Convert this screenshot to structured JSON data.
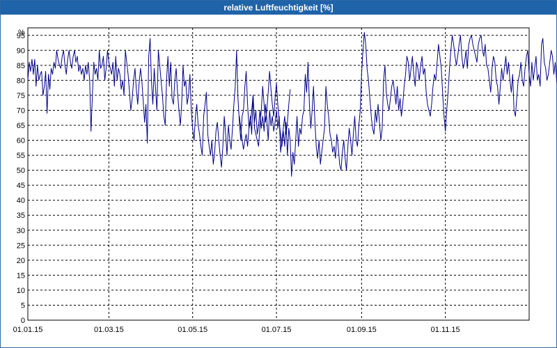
{
  "window": {
    "title": "relative Luftfeuchtigkeit [%]"
  },
  "colors": {
    "titlebar": "#1f63a8",
    "series": "#00008b",
    "grid": "#000000"
  },
  "chart_data": {
    "type": "line",
    "title": "relative Luftfeuchtigkeit [%]",
    "ylabel": "%",
    "ylim": [
      0,
      97.5
    ],
    "xlim": [
      "2015-01-01",
      "2016-01-01"
    ],
    "grid": true,
    "y_ticks": [
      0,
      5,
      10,
      15,
      20,
      25,
      30,
      35,
      40,
      45,
      50,
      55,
      60,
      65,
      70,
      75,
      80,
      85,
      90,
      95
    ],
    "x_ticks": [
      "01.01.15",
      "01.03.15",
      "01.05.15",
      "01.07.15",
      "01.09.15",
      "01.11.15"
    ],
    "x_tick_dates": [
      "2015-01-01",
      "2015-03-01",
      "2015-05-01",
      "2015-07-01",
      "2015-09-01",
      "2015-11-01"
    ],
    "series": [
      {
        "name": "",
        "segments": [
          {
            "start": "2015-01-01",
            "values": [
              80,
              86,
              83,
              87,
              82,
              87,
              78,
              85,
              80,
              82,
              83,
              75,
              78,
              83,
              69,
              82,
              77,
              84,
              82,
              86,
              84,
              90,
              87,
              85,
              84,
              88,
              90,
              85,
              82,
              87,
              90,
              86,
              84,
              88,
              90,
              86,
              88,
              83,
              85,
              82,
              84,
              80,
              85,
              82,
              86,
              80,
              63,
              75,
              86,
              82,
              84,
              80,
              90,
              84,
              85,
              88,
              80,
              84,
              90,
              86,
              84,
              82,
              86,
              78,
              88,
              80,
              84,
              82,
              77,
              80,
              75,
              90,
              86,
              82,
              76,
              70,
              74,
              80,
              84,
              77,
              72,
              79,
              84,
              80,
              73,
              66,
              72,
              59,
              88,
              94,
              80,
              72,
              84,
              77,
              70,
              90,
              85,
              80,
              75,
              68,
              65,
              80,
              88,
              78,
              86,
              74,
              72,
              80,
              84,
              76,
              70,
              65,
              72,
              85,
              78,
              80,
              72,
              75,
              82,
              70,
              64,
              60,
              68,
              72,
              65,
              62,
              58,
              55,
              68,
              72,
              76,
              62,
              58,
              55,
              60,
              52,
              56,
              63,
              66,
              60,
              55,
              51,
              58,
              68,
              62,
              55,
              65,
              60,
              57,
              64,
              72,
              78,
              90,
              74,
              66,
              60,
              68,
              70,
              78,
              83,
              72,
              64,
              68,
              62,
              75,
              66,
              70,
              62,
              65,
              70,
              64,
              68,
              63,
              72,
              67,
              60,
              70,
              65,
              68,
              63,
              66,
              70,
              64,
              68,
              56,
              60,
              64,
              68,
              62,
              66,
              72,
              77
            ]
          },
          {
            "start": "2015-06-04",
            "values": [
              68,
              64,
              60,
              57,
              60,
              62,
              58,
              64,
              66,
              70,
              75,
              64,
              62,
              60,
              58,
              65,
              70,
              78,
              72,
              66,
              70,
              76,
              83,
              77,
              72,
              68,
              74,
              79,
              72,
              66,
              62,
              58,
              63,
              58,
              66,
              55,
              64,
              60,
              48,
              56,
              52,
              60,
              68,
              58,
              64,
              62,
              68,
              70,
              82,
              76,
              86,
              72,
              64,
              70,
              78,
              66,
              58,
              54,
              60,
              52,
              56,
              60,
              64,
              78,
              72,
              68,
              62,
              60,
              56,
              58,
              54,
              62,
              58,
              52,
              50,
              56,
              60,
              54,
              50,
              58,
              64,
              60,
              55,
              62,
              68,
              60,
              58,
              65,
              70,
              82,
              90,
              96,
              92,
              84,
              80,
              74,
              68,
              64,
              62,
              70,
              66,
              72,
              66,
              60,
              64,
              80,
              85,
              76,
              72,
              70,
              74,
              78,
              80,
              76,
              72,
              78,
              70,
              74,
              68,
              72,
              78,
              82,
              88,
              86,
              80,
              84,
              88,
              82,
              78,
              86,
              84,
              80,
              85,
              88,
              82,
              84,
              76,
              72,
              70,
              68,
              72,
              78,
              82,
              80,
              86,
              92,
              88,
              84,
              76,
              68,
              63,
              70,
              76,
              84,
              90,
              95,
              92,
              88,
              85,
              88,
              92,
              95,
              88,
              84,
              86,
              90,
              84,
              92,
              94,
              95,
              92,
              90,
              88,
              86,
              92,
              94,
              95,
              90,
              88,
              92,
              85,
              84,
              80,
              76,
              84,
              88,
              86,
              80,
              78,
              72,
              78,
              84,
              80,
              84,
              88,
              82,
              86,
              80,
              76,
              82,
              70,
              68,
              74,
              80,
              82,
              86,
              80,
              78,
              84,
              88,
              90,
              82,
              78,
              86,
              80,
              84,
              88,
              80,
              82,
              78,
              92,
              94,
              86,
              84,
              80,
              82,
              86,
              90,
              88,
              82,
              86,
              80,
              78,
              84,
              82,
              80,
              84,
              92,
              95,
              88,
              82
            ]
          }
        ]
      }
    ]
  }
}
